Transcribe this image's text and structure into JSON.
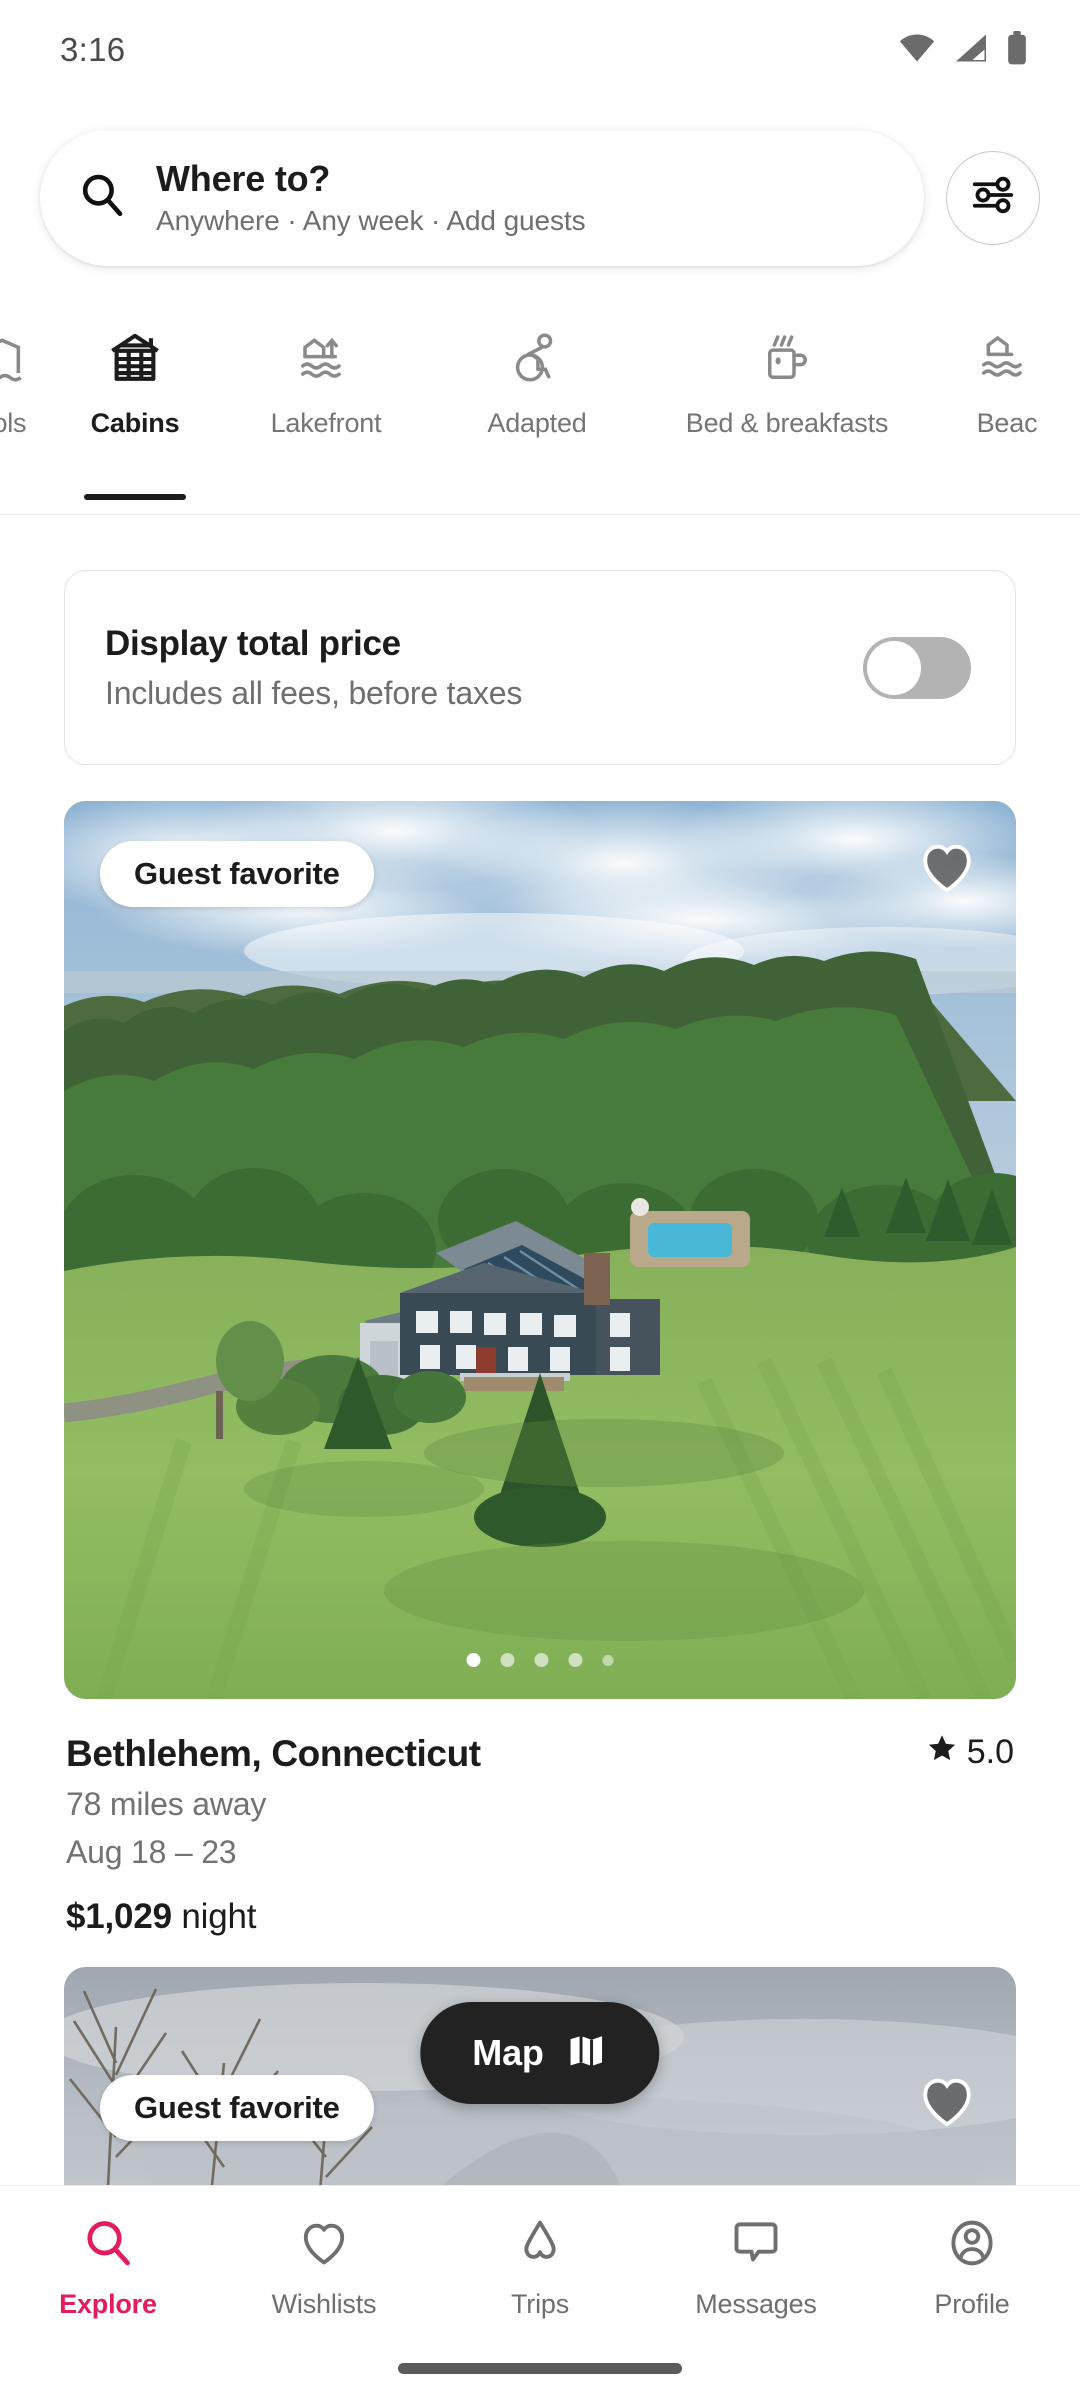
{
  "status_bar": {
    "time": "3:16",
    "icons": [
      "wifi-icon",
      "cellular-signal-icon",
      "battery-icon"
    ]
  },
  "search": {
    "icon": "search-icon",
    "title": "Where to?",
    "subtitle": "Anywhere · Any week · Add guests",
    "filter_icon": "filter-sliders-icon"
  },
  "tabs": [
    {
      "label": "ools",
      "icon": "pool-icon",
      "active": false,
      "partial": true
    },
    {
      "label": "Cabins",
      "icon": "cabin-icon",
      "active": true,
      "partial": false
    },
    {
      "label": "Lakefront",
      "icon": "lakefront-icon",
      "active": false,
      "partial": false
    },
    {
      "label": "Adapted",
      "icon": "accessible-icon",
      "active": false,
      "partial": false
    },
    {
      "label": "Bed & breakfasts",
      "icon": "coffee-cup-icon",
      "active": false,
      "partial": false
    },
    {
      "label": "Beac",
      "icon": "beachfront-icon",
      "active": false,
      "partial": true
    }
  ],
  "price_toggle": {
    "title": "Display total price",
    "subtitle": "Includes all fees, before taxes",
    "state": "off"
  },
  "listings": [
    {
      "badge": "Guest favorite",
      "favorite_icon": "heart-icon",
      "title": "Bethlehem, Connecticut",
      "rating": "5.0",
      "star_icon": "star-icon",
      "distance": "78 miles away",
      "dates": "Aug 18 – 23",
      "price_amount": "$1,029",
      "price_unit": "night",
      "photo_count": 5,
      "photo_active": 1
    },
    {
      "badge": "Guest favorite",
      "favorite_icon": "heart-icon"
    }
  ],
  "map_button": {
    "label": "Map",
    "icon": "map-fold-icon"
  },
  "bottom_nav": [
    {
      "label": "Explore",
      "icon": "search-icon",
      "active": true
    },
    {
      "label": "Wishlists",
      "icon": "heart-outline-icon",
      "active": false
    },
    {
      "label": "Trips",
      "icon": "airbnb-bellhop-icon",
      "active": false
    },
    {
      "label": "Messages",
      "icon": "message-bubble-icon",
      "active": false
    },
    {
      "label": "Profile",
      "icon": "user-circle-icon",
      "active": false
    }
  ],
  "colors": {
    "brand": "#E31C5F",
    "text_primary": "#1c1c1c",
    "text_secondary": "#717171",
    "map_button_bg": "#222222",
    "toggle_off_track": "#b3b3b3"
  }
}
